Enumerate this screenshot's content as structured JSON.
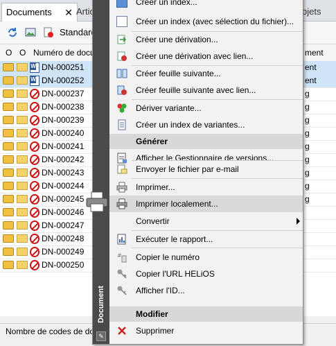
{
  "tabs": {
    "documents": "Documents",
    "close": "✕",
    "articles": "Artic",
    "objets": "bjets"
  },
  "toolbar": {
    "selector": "Standard"
  },
  "grid": {
    "headers": {
      "c1": "O",
      "c2": "O",
      "number": "Numéro de docu",
      "right": "ment"
    },
    "rows": [
      {
        "num": "DN-000251",
        "type": "word",
        "right": "ent"
      },
      {
        "num": "DN-000252",
        "type": "word",
        "right": "ent"
      },
      {
        "num": "DN-000237",
        "type": "nofile",
        "right": "g"
      },
      {
        "num": "DN-000238",
        "type": "nofile",
        "right": "g"
      },
      {
        "num": "DN-000239",
        "type": "nofile",
        "right": "g"
      },
      {
        "num": "DN-000240",
        "type": "nofile",
        "right": "g"
      },
      {
        "num": "DN-000241",
        "type": "nofile",
        "right": "g"
      },
      {
        "num": "DN-000242",
        "type": "nofile",
        "right": "g"
      },
      {
        "num": "DN-000243",
        "type": "nofile",
        "right": "g"
      },
      {
        "num": "DN-000244",
        "type": "nofile",
        "right": "g"
      },
      {
        "num": "DN-000245",
        "type": "nofile",
        "right": "g"
      },
      {
        "num": "DN-000246",
        "type": "nofile",
        "right": ""
      },
      {
        "num": "DN-000247",
        "type": "nofile",
        "right": ""
      },
      {
        "num": "DN-000248",
        "type": "nofile",
        "right": ""
      },
      {
        "num": "DN-000249",
        "type": "nofile",
        "right": ""
      },
      {
        "num": "DN-000250",
        "type": "nofile",
        "right": ""
      }
    ]
  },
  "status": {
    "text": "Nombre de codes de do"
  },
  "menu": {
    "side_label": "Document",
    "items": {
      "creer_index": "Créer un index...",
      "creer_index_sel": "Créer un index (avec sélection du fichier)...",
      "creer_derivation": "Créer une dérivation...",
      "creer_derivation_lien": "Créer une dérivation avec lien...",
      "creer_feuille": "Créer feuille suivante...",
      "creer_feuille_lien": "Créer feuille suivante avec lien...",
      "deriver_variante": "Dériver variante...",
      "creer_index_variantes": "Créer un index de variantes...",
      "generer_header": "Générer",
      "gestionnaire_versions": "Afficher le Gestionnaire de versions...",
      "envoyer_mail": "Envoyer le fichier par e-mail",
      "imprimer": "Imprimer...",
      "imprimer_local": "Imprimer localement...",
      "convertir": "Convertir",
      "executer_rapport": "Exécuter le rapport...",
      "copier_numero": "Copier le numéro",
      "copier_url": "Copier l'URL HELiOS",
      "afficher_id": "Afficher l'ID...",
      "modifier_header": "Modifier",
      "supprimer": "Supprimer"
    }
  }
}
